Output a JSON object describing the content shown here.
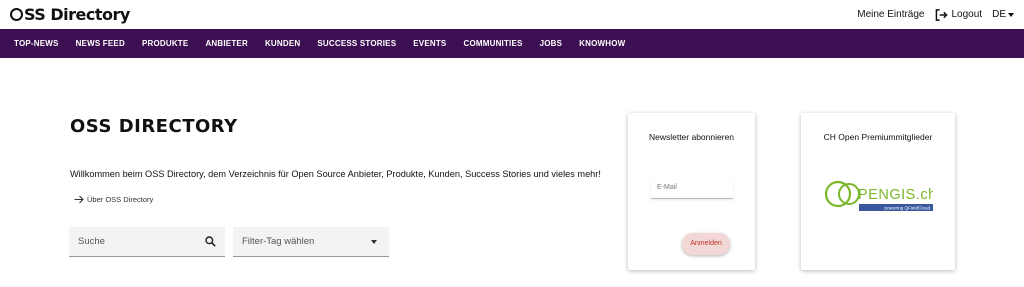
{
  "header": {
    "logo_text": "SS Directory",
    "my_entries": "Meine Einträge",
    "logout": "Logout",
    "language": "DE"
  },
  "nav": {
    "items": [
      "TOP-NEWS",
      "NEWS FEED",
      "PRODUKTE",
      "ANBIETER",
      "KUNDEN",
      "SUCCESS STORIES",
      "EVENTS",
      "COMMUNITIES",
      "JOBS",
      "KNOWHOW"
    ]
  },
  "main": {
    "title": "OSS DIRECTORY",
    "intro": "Willkommen beim OSS Directory, dem Verzeichnis für Open Source Anbieter, Produkte, Kunden, Success Stories und vieles mehr!",
    "about_link": "Über OSS Directory",
    "search_placeholder": "Suche",
    "filter_placeholder": "Filter-Tag wählen"
  },
  "newsletter": {
    "title": "Newsletter abonnieren",
    "email_placeholder": "E-Mail",
    "subscribe": "Anmelden"
  },
  "members": {
    "title": "CH Open Premiummitglieder",
    "logo_main": "PENGIS.ch",
    "logo_sub": "powering QFieldCloud"
  },
  "colors": {
    "nav_bg": "#3c0f52",
    "logo_green": "#7ab829",
    "logo_blue": "#3a57a0",
    "subscribe_bg": "#f3d6d6",
    "subscribe_text": "#c0392b"
  }
}
